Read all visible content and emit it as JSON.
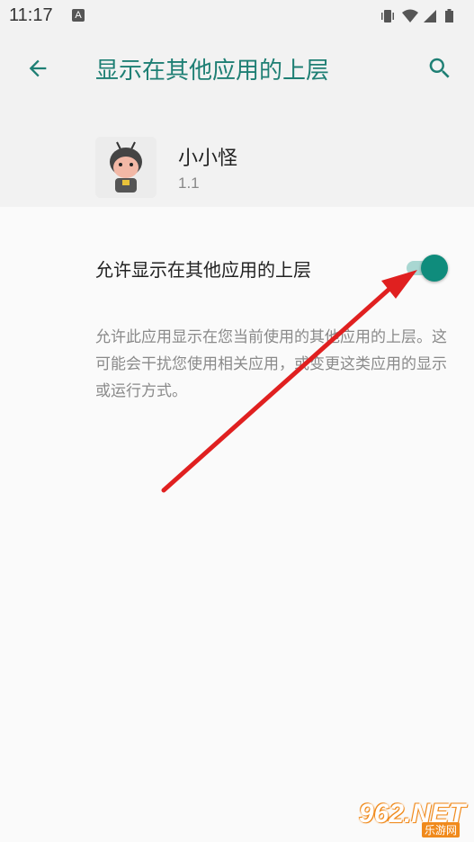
{
  "status_bar": {
    "time": "11:17",
    "notification_icon": "A",
    "icons": [
      "vibrate-icon",
      "wifi-icon",
      "signal-icon",
      "battery-icon"
    ]
  },
  "app_bar": {
    "title": "显示在其他应用的上层",
    "back_icon": "arrow-back-icon",
    "search_icon": "search-icon"
  },
  "app": {
    "name": "小小怪",
    "version": "1.1"
  },
  "setting": {
    "label": "允许显示在其他应用的上层",
    "enabled": true,
    "description": "允许此应用显示在您当前使用的其他应用的上层。这可能会干扰您使用相关应用，或变更这类应用的显示或运行方式。"
  },
  "watermark": {
    "text": "962.NET",
    "sub": "乐游网"
  },
  "colors": {
    "accent": "#1e7f74",
    "toggle_thumb": "#0f8c7c",
    "toggle_track": "#a9d7d2",
    "arrow": "#e02020"
  }
}
